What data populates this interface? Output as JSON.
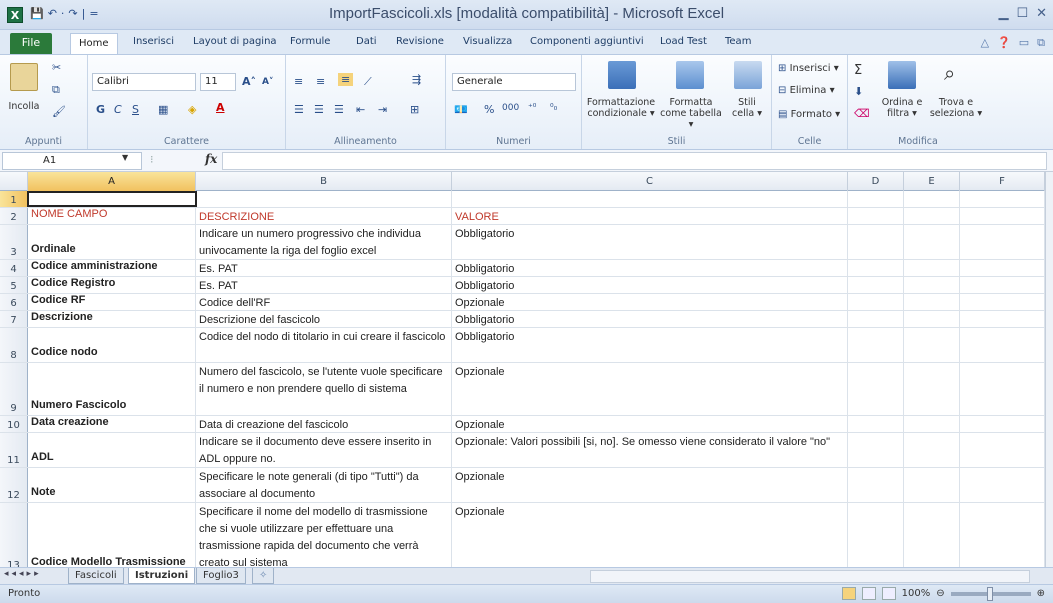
{
  "window": {
    "title": "ImportFascicoli.xls  [modalità compatibilità]  -  Microsoft Excel",
    "app_icon": "X"
  },
  "qat": {
    "items": [
      "💾",
      "↶",
      "·",
      "↷",
      "|",
      "="
    ]
  },
  "menu": {
    "file": "File",
    "tabs": [
      "Home",
      "Inserisci",
      "Layout di pagina",
      "Formule",
      "Dati",
      "Revisione",
      "Visualizza",
      "Componenti aggiuntivi",
      "Load Test",
      "Team"
    ]
  },
  "ribbon": {
    "clipboard": {
      "paste": "Incolla",
      "label": "Appunti"
    },
    "font": {
      "name": "Calibri",
      "size": "11",
      "bold": "G",
      "italic": "C",
      "underline": "S",
      "label": "Carattere"
    },
    "alignment": {
      "label": "Allineamento"
    },
    "number": {
      "format": "Generale",
      "percent": "%",
      "thousands": "000",
      "label": "Numeri"
    },
    "styles": {
      "conditional": "Formattazione condizionale ▾",
      "table": "Formatta come tabella ▾",
      "cell": "Stili cella ▾",
      "label": "Stili"
    },
    "cells": {
      "insert": "Inserisci ▾",
      "delete": "Elimina ▾",
      "format": "Formato ▾",
      "label": "Celle"
    },
    "editing": {
      "sort": "Ordina e filtra ▾",
      "find": "Trova e seleziona ▾",
      "label": "Modifica"
    }
  },
  "formula_bar": {
    "cell_ref": "A1",
    "fx": "fx",
    "value": ""
  },
  "columns": [
    "A",
    "B",
    "C",
    "D",
    "E",
    "F"
  ],
  "rows": [
    {
      "num": "1",
      "a": "",
      "b": "",
      "c": ""
    },
    {
      "num": "2",
      "a": "NOME CAMPO",
      "b": "DESCRIZIONE",
      "c": "VALORE"
    },
    {
      "num": "3",
      "a": "Ordinale",
      "b": "Indicare un numero progressivo che individua univocamente la riga del foglio excel",
      "c": "Obbligatorio"
    },
    {
      "num": "4",
      "a": "Codice amministrazione",
      "b": "Es. PAT",
      "c": "Obbligatorio"
    },
    {
      "num": "5",
      "a": "Codice Registro",
      "b": "Es. PAT",
      "c": "Obbligatorio"
    },
    {
      "num": "6",
      "a": "Codice RF",
      "b": "Codice dell'RF",
      "c": "Opzionale"
    },
    {
      "num": "7",
      "a": "Descrizione",
      "b": "Descrizione del fascicolo",
      "c": "Obbligatorio"
    },
    {
      "num": "8",
      "a": "Codice nodo",
      "b": "Codice del nodo di titolario in cui creare il fascicolo",
      "c": "Obbligatorio"
    },
    {
      "num": "9",
      "a": "Numero Fascicolo",
      "b": "Numero del fascicolo, se l'utente vuole specificare il numero e non prendere quello di sistema",
      "c": "Opzionale"
    },
    {
      "num": "10",
      "a": "Data creazione",
      "b": "Data di creazione del fascicolo",
      "c": "Opzionale"
    },
    {
      "num": "11",
      "a": "ADL",
      "b": "Indicare se il documento deve essere inserito in ADL oppure no.",
      "c": "Opzionale: Valori possibili [si, no]. Se omesso viene considerato il valore \"no\""
    },
    {
      "num": "12",
      "a": "Note",
      "b": "Specificare le note generali (di tipo \"Tutti\") da associare al documento",
      "c": "Opzionale"
    },
    {
      "num": "13",
      "a": "Codice Modello Trasmissione",
      "b": "Specificare il nome del modello di trasmissione che si vuole utilizzare per effettuare una trasmissione rapida del documento che verrà creato sul sistema",
      "c": "Opzionale"
    }
  ],
  "sheets": {
    "tabs": [
      "Fascicoli",
      "Istruzioni",
      "Foglio3"
    ],
    "active": "Istruzioni"
  },
  "status": {
    "text": "Pronto",
    "zoom": "100%"
  }
}
